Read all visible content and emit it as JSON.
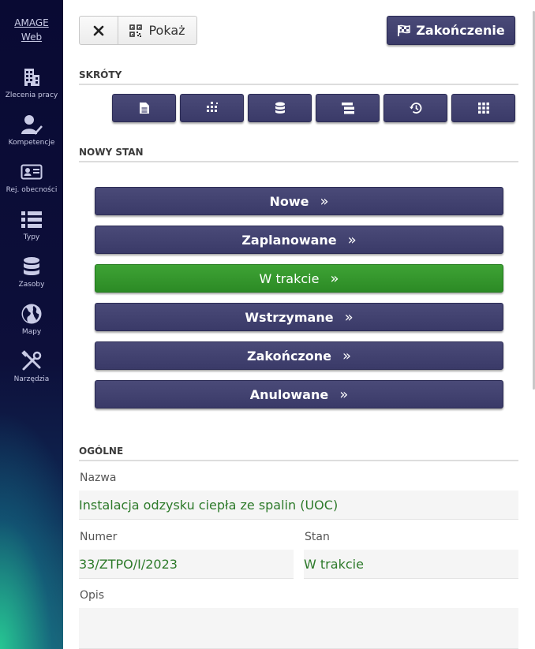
{
  "sidebar": {
    "brand_line1": "AMAGE",
    "brand_line2": "Web",
    "items": [
      {
        "icon": "building-icon",
        "label": "Zlecenia pracy"
      },
      {
        "icon": "user-check-icon",
        "label": "Kompetencje"
      },
      {
        "icon": "id-card-icon",
        "label": "Rej. obecności"
      },
      {
        "icon": "list-icon",
        "label": "Typy"
      },
      {
        "icon": "database-icon",
        "label": "Zasoby"
      },
      {
        "icon": "globe-icon",
        "label": "Mapy"
      },
      {
        "icon": "tools-icon",
        "label": "Narzędzia"
      }
    ]
  },
  "toolbar": {
    "close_icon": "close-icon",
    "show_label": "Pokaż",
    "finish_label": "Zakończenie"
  },
  "shortcuts": {
    "title": "SKRÓTY",
    "icons": [
      "document-icon",
      "dots-grid-icon",
      "database-icon",
      "tree-icon",
      "history-icon",
      "grid-icon"
    ]
  },
  "new_state": {
    "title": "NOWY STAN",
    "states": [
      {
        "label": "Nowe",
        "active": false
      },
      {
        "label": "Zaplanowane",
        "active": false
      },
      {
        "label": "W trakcie",
        "active": true
      },
      {
        "label": "Wstrzymane",
        "active": false
      },
      {
        "label": "Zakończone",
        "active": false
      },
      {
        "label": "Anulowane",
        "active": false
      }
    ]
  },
  "general": {
    "title": "OGÓLNE",
    "name_label": "Nazwa",
    "name_value": "Instalacja odzysku ciepła ze spalin (UOC)",
    "number_label": "Numer",
    "number_value": "33/ZTPO/I/2023",
    "state_label": "Stan",
    "state_value": "W trakcie",
    "desc_label": "Opis",
    "desc_value": ""
  },
  "colors": {
    "sidebar_bg": "#0d0f3a",
    "dark_button": "#3f3f6e",
    "active_state": "#34962d",
    "value_text": "#2d7a2a"
  }
}
